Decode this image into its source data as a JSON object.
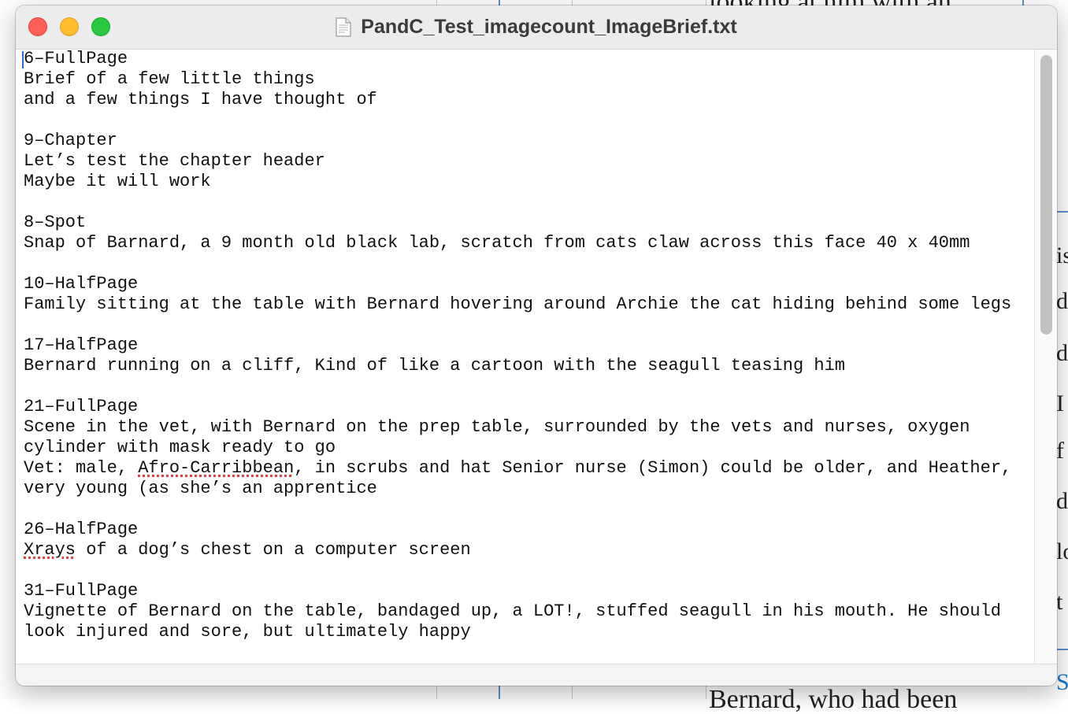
{
  "background_app": {
    "top_text": "looking at him with an",
    "bottom_text": "Bernard, who had been",
    "edge_chars": [
      "is",
      "d",
      "d",
      "I",
      "f",
      "d",
      "lo",
      "t"
    ],
    "edge_blue_char": "S"
  },
  "window": {
    "title": "PandC_Test_imagecount_ImageBrief.txt",
    "file_icon": "text-document-icon",
    "traffic_lights": {
      "close": "close-button",
      "minimize": "minimize-button",
      "zoom": "zoom-button"
    }
  },
  "document": {
    "lines": [
      "6–FullPage",
      "Brief of a few little things",
      "and a few things I have thought of",
      "",
      "9–Chapter",
      "Let’s test the chapter header",
      "Maybe it will work",
      "",
      "8–Spot",
      "Snap of Barnard, a 9 month old black lab, scratch from cats claw across this face 40 x 40mm",
      "",
      "10–HalfPage",
      "Family sitting at the table with Bernard hovering around Archie the cat hiding behind some legs",
      "",
      "17–HalfPage",
      "Bernard running on a cliff, Kind of like a cartoon with the seagull teasing him",
      "",
      "21–FullPage",
      "Scene in the vet, with Bernard on the prep table, surrounded by the vets and nurses, oxygen",
      "cylinder with mask ready to go",
      "Vet: male, Afro-Carribbean, in scrubs and hat Senior nurse (Simon) could be older, and Heather,",
      "very young (as she’s an apprentice",
      "",
      "26–HalfPage",
      "Xrays of a dog’s chest on a computer screen",
      "",
      "31–FullPage",
      "Vignette of Bernard on the table, bandaged up, a LOT!, stuffed seagull in his mouth. He should",
      "look injured and sore, but ultimately happy"
    ],
    "misspelled": [
      "Afro-Carribbean",
      "Xrays"
    ]
  },
  "colors": {
    "close": "#fe5f57",
    "minimize": "#febc2e",
    "zoom": "#28c840",
    "cursor": "#2a6fd6",
    "spellcheck": "#e04040"
  }
}
